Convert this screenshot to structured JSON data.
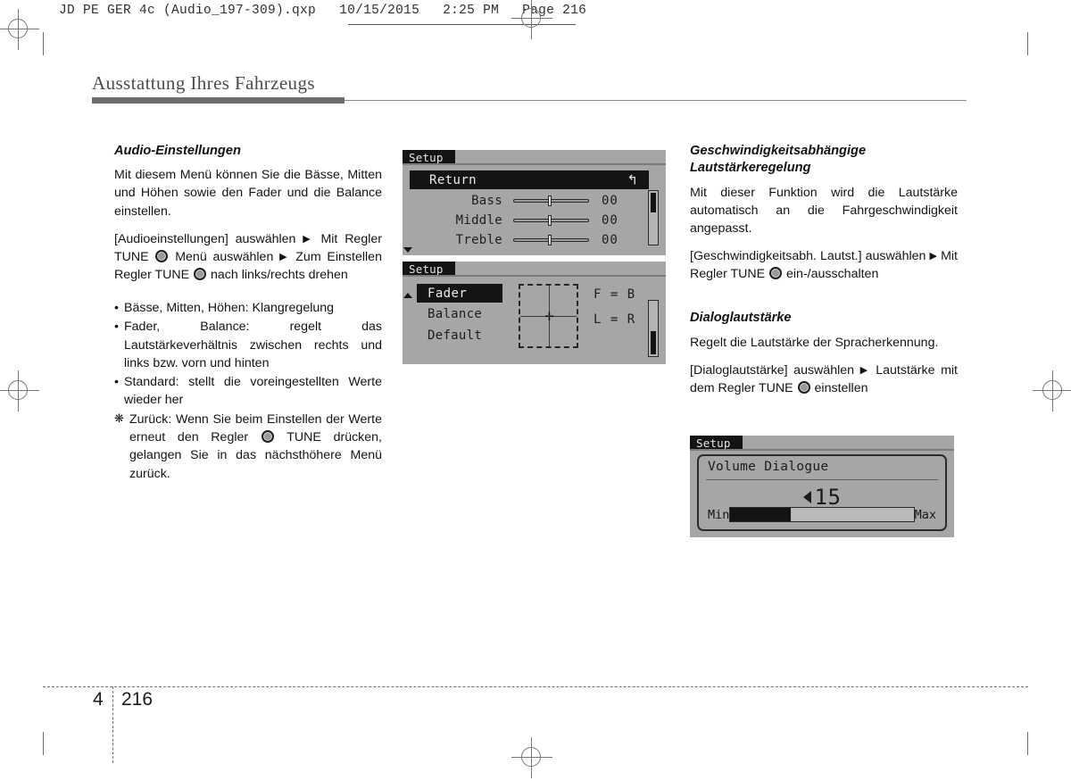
{
  "print_header": {
    "file": "JD PE GER 4c (Audio_197-309).qxp",
    "date": "10/15/2015",
    "time": "2:25 PM",
    "page": "Page 216"
  },
  "chapter": {
    "title": "Ausstattung Ihres Fahrzeugs"
  },
  "left_column": {
    "section_title": "Audio-Einstellungen",
    "intro": "Mit diesem Menü können Sie die Bässe, Mitten und Höhen sowie den Fader und die Balance einstellen.",
    "instruction_1": "[Audioeinstellungen] auswählen",
    "instruction_2": "Mit Regler TUNE",
    "instruction_3": "Menü auswählen",
    "instruction_4": "Zum Einstellen Regler TUNE",
    "instruction_5": "nach links/rechts drehen",
    "bullets": [
      {
        "marker": "•",
        "text": "Bässe, Mitten, Höhen: Klangregelung"
      },
      {
        "marker": "•",
        "text": "Fader, Balance: regelt das Lautstärkeverhältnis zwischen rechts und links bzw. vorn und hinten"
      },
      {
        "marker": "•",
        "text": "Standard: stellt die voreingestellten Werte wieder her"
      }
    ],
    "note": {
      "marker": "❋",
      "part_1": "Zurück: Wenn Sie beim Einstellen der Werte erneut den Regler",
      "part_2": "TUNE drücken, gelangen Sie in das nächsthöhere Menü zurück."
    }
  },
  "right_column": {
    "section_1_title": "Geschwindigkeitsabhängige Lautstärkeregelung",
    "section_1_body": "Mit dieser Funktion wird die Lautstärke automatisch an die Fahrgeschwindigkeit angepasst.",
    "section_1_instruction_1": "[Geschwindigkeitsabh. Lautst.] auswählen",
    "section_1_instruction_2": "Mit Regler TUNE",
    "section_1_instruction_3": "ein-/ausschalten",
    "section_2_title": "Dialoglautstärke",
    "section_2_body": "Regelt die Lautstärke der Spracherkennung.",
    "section_2_instruction_1": "[Dialoglautstärke] auswählen",
    "section_2_instruction_2": "Lautstärke mit dem Regler TUNE",
    "section_2_instruction_3": "einstellen"
  },
  "lcd_panel_audio": {
    "title": "Setup",
    "selected_row": "Return",
    "return_icon": "↰",
    "rows": [
      {
        "label": "Bass",
        "value": "00"
      },
      {
        "label": "Middle",
        "value": "00"
      },
      {
        "label": "Treble",
        "value": "00"
      }
    ]
  },
  "lcd_panel_fader": {
    "title": "Setup",
    "menu": [
      {
        "label": "Fader",
        "selected": true
      },
      {
        "label": "Balance",
        "selected": false
      },
      {
        "label": "Default",
        "selected": false
      }
    ],
    "axis_label_vertical": "F = B",
    "axis_label_horizontal": "L = R",
    "marker": "✛"
  },
  "lcd_panel_volume": {
    "title": "Setup",
    "dialog_title": "Volume Dialogue",
    "value": "15",
    "min_label": "Min",
    "max_label": "Max",
    "fill_percent": 33
  },
  "footer": {
    "chapter_number": "4",
    "page_number": "216"
  }
}
